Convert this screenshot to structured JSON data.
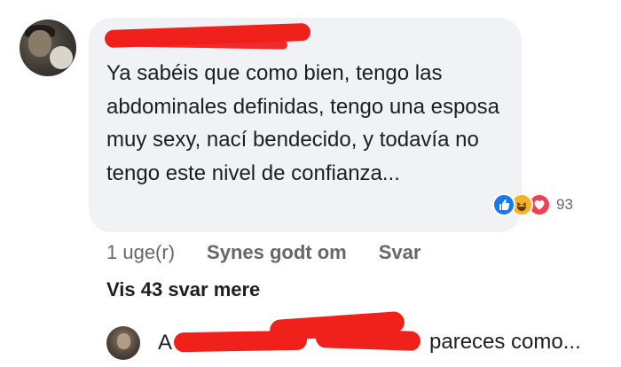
{
  "comment": {
    "author_visible": "",
    "text": "Ya sabéis que como bien, tengo las abdominales definidas, tengo una esposa muy sexy, nací bendecido, y todavía no tengo este nivel de confianza...",
    "reactions": {
      "icons": [
        "like-icon",
        "haha-icon",
        "love-icon"
      ],
      "count": "93"
    },
    "actions": {
      "timestamp": "1 uge(r)",
      "like_label": "Synes godt om",
      "reply_label": "Svar"
    }
  },
  "more_replies_label": "Vis 43 svar mere",
  "reply": {
    "author_prefix": "A",
    "text": "pareces como..."
  },
  "colors": {
    "bubble": "#f0f2f5",
    "redaction": "#f0201b",
    "like": "#1877f2",
    "haha": "#f7b125",
    "love": "#f33e58",
    "secondary_text": "#65676b"
  }
}
